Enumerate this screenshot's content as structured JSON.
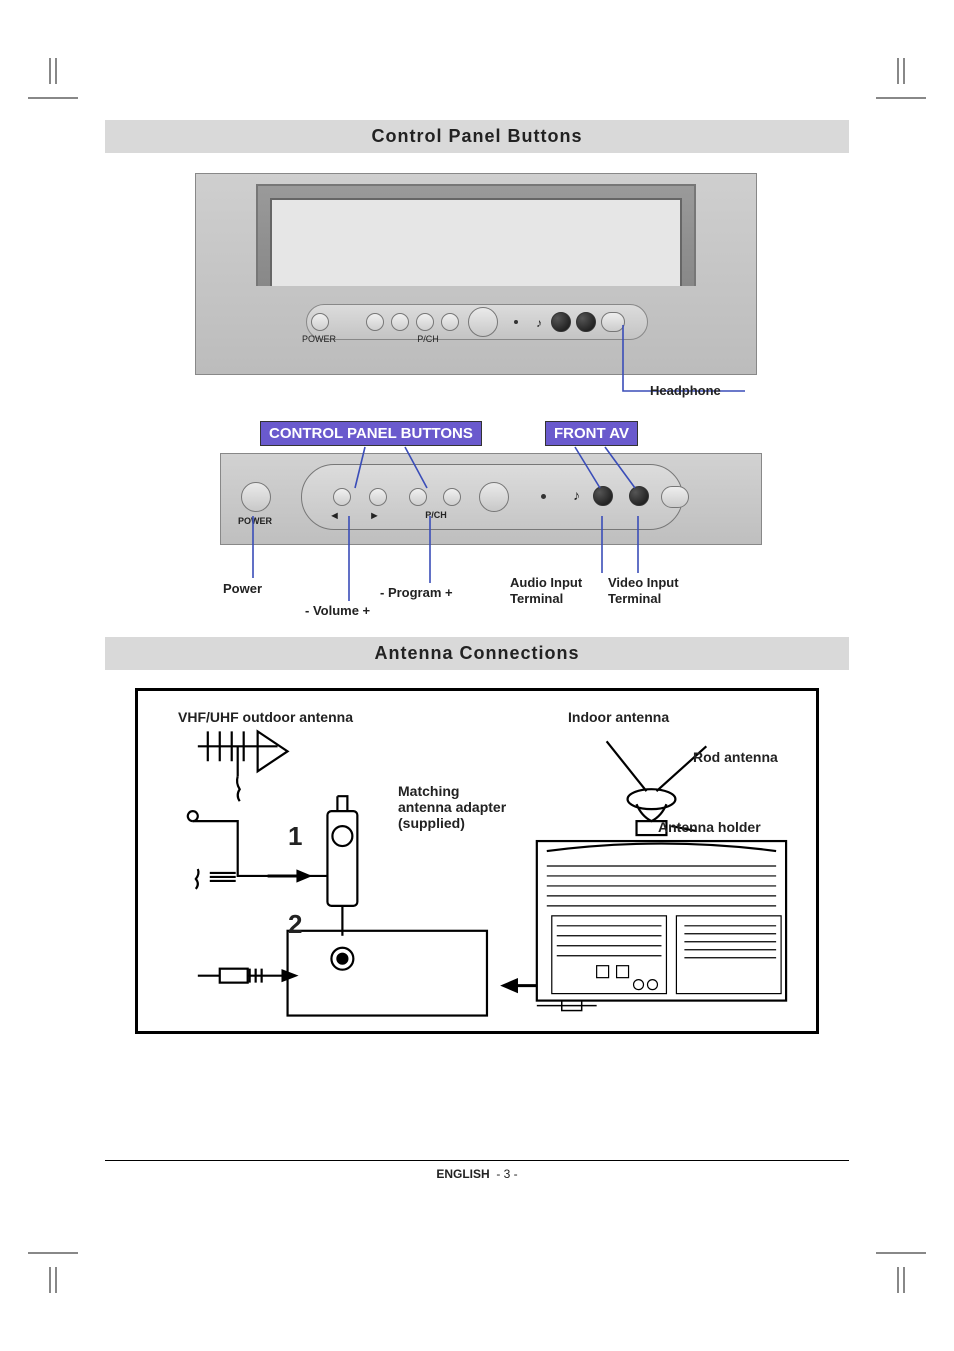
{
  "sections": {
    "control_panel_title": "Control Panel Buttons",
    "antenna_title": "Antenna Connections"
  },
  "callouts": {
    "control_panel_buttons": "CONTROL PANEL BUTTONS",
    "front_av": "FRONT AV"
  },
  "labels": {
    "headphone": "Headphone",
    "power": "Power",
    "program": "- Program +",
    "volume": "- Volume +",
    "audio_input": "Audio Input Terminal",
    "video_input": "Video Input Terminal",
    "power_small": "POWER",
    "pch_small": "P/CH"
  },
  "antenna": {
    "vhf_uhf": "VHF/UHF outdoor antenna",
    "indoor": "Indoor antenna",
    "rod": "Rod antenna",
    "holder": "Antenna holder",
    "matching": "Matching antenna adapter (supplied)",
    "num1": "1",
    "num2": "2"
  },
  "footer": {
    "lang": "ENGLISH",
    "page": "- 3 -"
  }
}
